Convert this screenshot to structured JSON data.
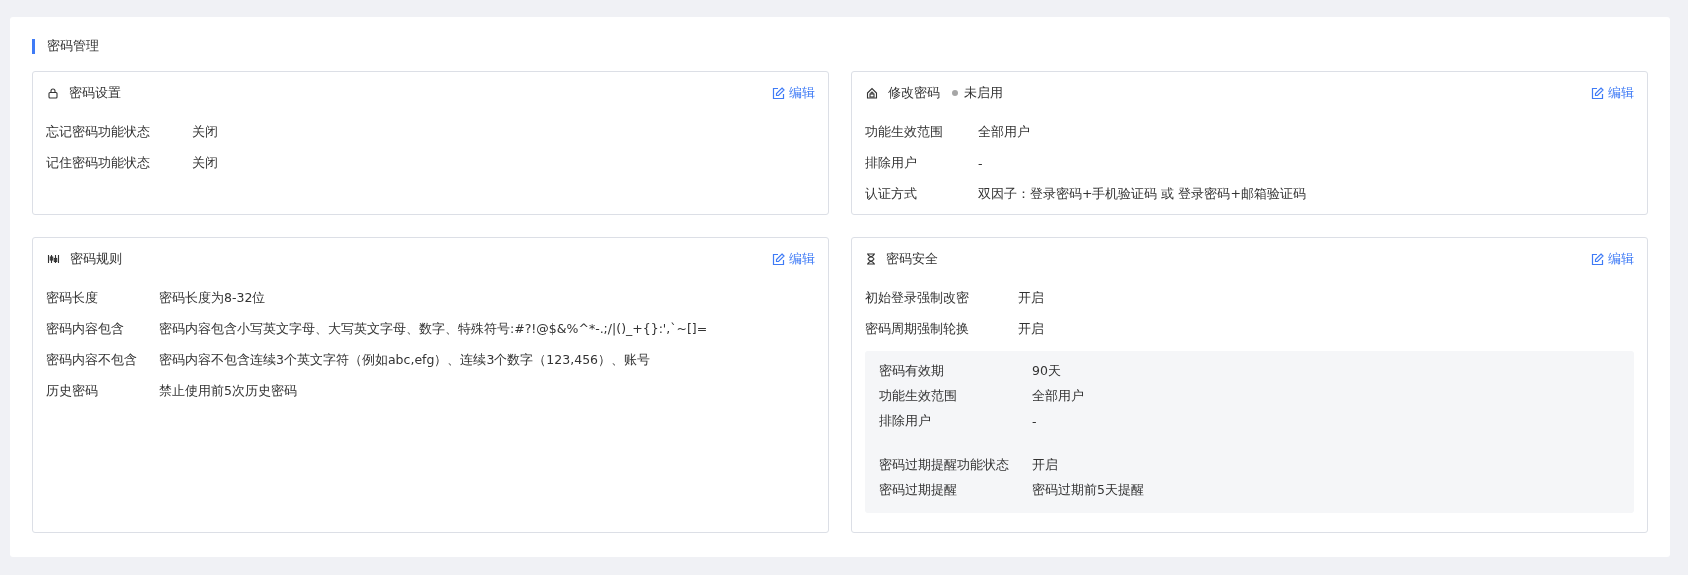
{
  "page_title": "密码管理",
  "cards": [
    {
      "title": "密码设置",
      "edit": "编辑",
      "rows": [
        {
          "label": "忘记密码功能状态",
          "value": "关闭"
        },
        {
          "label": "记住密码功能状态",
          "value": "关闭"
        }
      ]
    },
    {
      "title": "修改密码",
      "status": {
        "text": "未启用",
        "color": "#a6a6a6"
      },
      "edit": "编辑",
      "rows": [
        {
          "label": "功能生效范围",
          "value": "全部用户"
        },
        {
          "label": "排除用户",
          "value": "-"
        },
        {
          "label": "认证方式",
          "value": "双因子：登录密码+手机验证码 或 登录密码+邮箱验证码"
        }
      ]
    },
    {
      "title": "密码规则",
      "edit": "编辑",
      "rows": [
        {
          "label": "密码长度",
          "value": "密码长度为8-32位"
        },
        {
          "label": "密码内容包含",
          "value": "密码内容包含小写英文字母、大写英文字母、数字、特殊符号:#?!@$&%^*-.;/|()_+{}:',`~[]="
        },
        {
          "label": "密码内容不包含",
          "value": "密码内容不包含连续3个英文字符（例如abc,efg）、连续3个数字（123,456）、账号"
        },
        {
          "label": "历史密码",
          "value": "禁止使用前5次历史密码"
        }
      ]
    },
    {
      "title": "密码安全",
      "edit": "编辑",
      "rows": [
        {
          "label": "初始登录强制改密",
          "value": "开启"
        },
        {
          "label": "密码周期强制轮换",
          "value": "开启"
        }
      ],
      "detail_groups": [
        [
          {
            "label": "密码有效期",
            "value": "90天"
          },
          {
            "label": "功能生效范围",
            "value": "全部用户"
          },
          {
            "label": "排除用户",
            "value": "-"
          }
        ],
        [
          {
            "label": "密码过期提醒功能状态",
            "value": "开启"
          },
          {
            "label": "密码过期提醒",
            "value": "密码过期前5天提醒"
          }
        ]
      ]
    }
  ]
}
